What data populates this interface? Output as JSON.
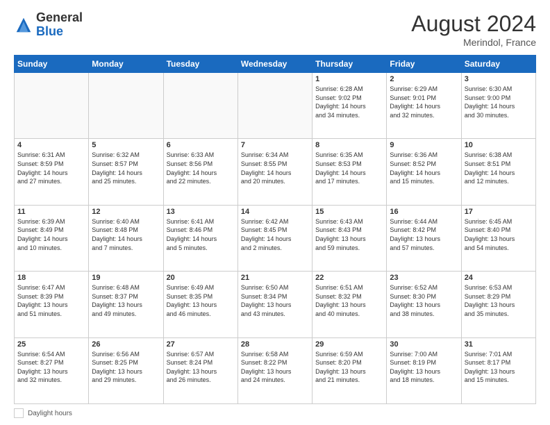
{
  "header": {
    "logo_general": "General",
    "logo_blue": "Blue",
    "month_year": "August 2024",
    "location": "Merindol, France"
  },
  "footer": {
    "label": "Daylight hours"
  },
  "days_of_week": [
    "Sunday",
    "Monday",
    "Tuesday",
    "Wednesday",
    "Thursday",
    "Friday",
    "Saturday"
  ],
  "weeks": [
    [
      {
        "day": "",
        "info": ""
      },
      {
        "day": "",
        "info": ""
      },
      {
        "day": "",
        "info": ""
      },
      {
        "day": "",
        "info": ""
      },
      {
        "day": "1",
        "info": "Sunrise: 6:28 AM\nSunset: 9:02 PM\nDaylight: 14 hours\nand 34 minutes."
      },
      {
        "day": "2",
        "info": "Sunrise: 6:29 AM\nSunset: 9:01 PM\nDaylight: 14 hours\nand 32 minutes."
      },
      {
        "day": "3",
        "info": "Sunrise: 6:30 AM\nSunset: 9:00 PM\nDaylight: 14 hours\nand 30 minutes."
      }
    ],
    [
      {
        "day": "4",
        "info": "Sunrise: 6:31 AM\nSunset: 8:59 PM\nDaylight: 14 hours\nand 27 minutes."
      },
      {
        "day": "5",
        "info": "Sunrise: 6:32 AM\nSunset: 8:57 PM\nDaylight: 14 hours\nand 25 minutes."
      },
      {
        "day": "6",
        "info": "Sunrise: 6:33 AM\nSunset: 8:56 PM\nDaylight: 14 hours\nand 22 minutes."
      },
      {
        "day": "7",
        "info": "Sunrise: 6:34 AM\nSunset: 8:55 PM\nDaylight: 14 hours\nand 20 minutes."
      },
      {
        "day": "8",
        "info": "Sunrise: 6:35 AM\nSunset: 8:53 PM\nDaylight: 14 hours\nand 17 minutes."
      },
      {
        "day": "9",
        "info": "Sunrise: 6:36 AM\nSunset: 8:52 PM\nDaylight: 14 hours\nand 15 minutes."
      },
      {
        "day": "10",
        "info": "Sunrise: 6:38 AM\nSunset: 8:51 PM\nDaylight: 14 hours\nand 12 minutes."
      }
    ],
    [
      {
        "day": "11",
        "info": "Sunrise: 6:39 AM\nSunset: 8:49 PM\nDaylight: 14 hours\nand 10 minutes."
      },
      {
        "day": "12",
        "info": "Sunrise: 6:40 AM\nSunset: 8:48 PM\nDaylight: 14 hours\nand 7 minutes."
      },
      {
        "day": "13",
        "info": "Sunrise: 6:41 AM\nSunset: 8:46 PM\nDaylight: 14 hours\nand 5 minutes."
      },
      {
        "day": "14",
        "info": "Sunrise: 6:42 AM\nSunset: 8:45 PM\nDaylight: 14 hours\nand 2 minutes."
      },
      {
        "day": "15",
        "info": "Sunrise: 6:43 AM\nSunset: 8:43 PM\nDaylight: 13 hours\nand 59 minutes."
      },
      {
        "day": "16",
        "info": "Sunrise: 6:44 AM\nSunset: 8:42 PM\nDaylight: 13 hours\nand 57 minutes."
      },
      {
        "day": "17",
        "info": "Sunrise: 6:45 AM\nSunset: 8:40 PM\nDaylight: 13 hours\nand 54 minutes."
      }
    ],
    [
      {
        "day": "18",
        "info": "Sunrise: 6:47 AM\nSunset: 8:39 PM\nDaylight: 13 hours\nand 51 minutes."
      },
      {
        "day": "19",
        "info": "Sunrise: 6:48 AM\nSunset: 8:37 PM\nDaylight: 13 hours\nand 49 minutes."
      },
      {
        "day": "20",
        "info": "Sunrise: 6:49 AM\nSunset: 8:35 PM\nDaylight: 13 hours\nand 46 minutes."
      },
      {
        "day": "21",
        "info": "Sunrise: 6:50 AM\nSunset: 8:34 PM\nDaylight: 13 hours\nand 43 minutes."
      },
      {
        "day": "22",
        "info": "Sunrise: 6:51 AM\nSunset: 8:32 PM\nDaylight: 13 hours\nand 40 minutes."
      },
      {
        "day": "23",
        "info": "Sunrise: 6:52 AM\nSunset: 8:30 PM\nDaylight: 13 hours\nand 38 minutes."
      },
      {
        "day": "24",
        "info": "Sunrise: 6:53 AM\nSunset: 8:29 PM\nDaylight: 13 hours\nand 35 minutes."
      }
    ],
    [
      {
        "day": "25",
        "info": "Sunrise: 6:54 AM\nSunset: 8:27 PM\nDaylight: 13 hours\nand 32 minutes."
      },
      {
        "day": "26",
        "info": "Sunrise: 6:56 AM\nSunset: 8:25 PM\nDaylight: 13 hours\nand 29 minutes."
      },
      {
        "day": "27",
        "info": "Sunrise: 6:57 AM\nSunset: 8:24 PM\nDaylight: 13 hours\nand 26 minutes."
      },
      {
        "day": "28",
        "info": "Sunrise: 6:58 AM\nSunset: 8:22 PM\nDaylight: 13 hours\nand 24 minutes."
      },
      {
        "day": "29",
        "info": "Sunrise: 6:59 AM\nSunset: 8:20 PM\nDaylight: 13 hours\nand 21 minutes."
      },
      {
        "day": "30",
        "info": "Sunrise: 7:00 AM\nSunset: 8:19 PM\nDaylight: 13 hours\nand 18 minutes."
      },
      {
        "day": "31",
        "info": "Sunrise: 7:01 AM\nSunset: 8:17 PM\nDaylight: 13 hours\nand 15 minutes."
      }
    ]
  ]
}
